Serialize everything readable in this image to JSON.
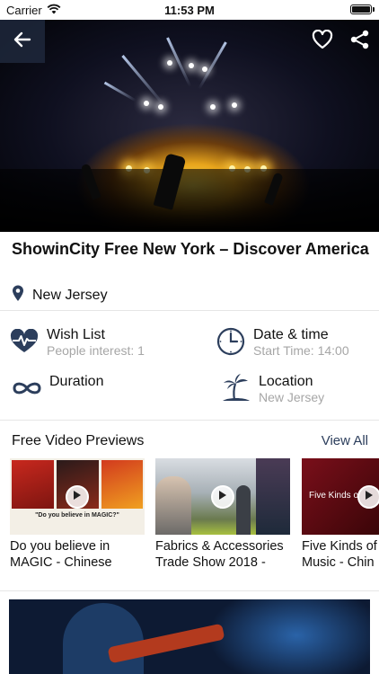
{
  "status_bar": {
    "carrier": "Carrier",
    "time": "11:53 PM"
  },
  "event": {
    "title": "ShowinCity Free New York – Discover America",
    "place": "New Jersey"
  },
  "info": {
    "wishlist": {
      "label": "Wish List",
      "sub": "People interest: 1"
    },
    "datetime": {
      "label": "Date & time",
      "sub": "Start Time: 14:00"
    },
    "duration": {
      "label": "Duration"
    },
    "location": {
      "label": "Location",
      "sub": "New Jersey"
    }
  },
  "videos": {
    "heading": "Free Video Previews",
    "view_all": "View All",
    "items": [
      {
        "caption_line1": "Do you believe in",
        "caption_line2": "MAGIC - Chinese",
        "thumb_text": "\"Do you believe in MAGIC?\""
      },
      {
        "caption_line1": "Fabrics & Accessories",
        "caption_line2": "Trade Show 2018 -"
      },
      {
        "caption_line1": "Five Kinds of",
        "caption_line2": "Music - Chin",
        "thumb_text": "Five Kinds o"
      }
    ]
  },
  "colors": {
    "accent": "#2c3e5c",
    "muted": "#a6a6a6",
    "divider": "#e6e6e6"
  },
  "icons": [
    "back-arrow",
    "heart-outline",
    "share",
    "map-pin",
    "heart-pulse",
    "clock",
    "infinity",
    "palm-island",
    "play"
  ]
}
